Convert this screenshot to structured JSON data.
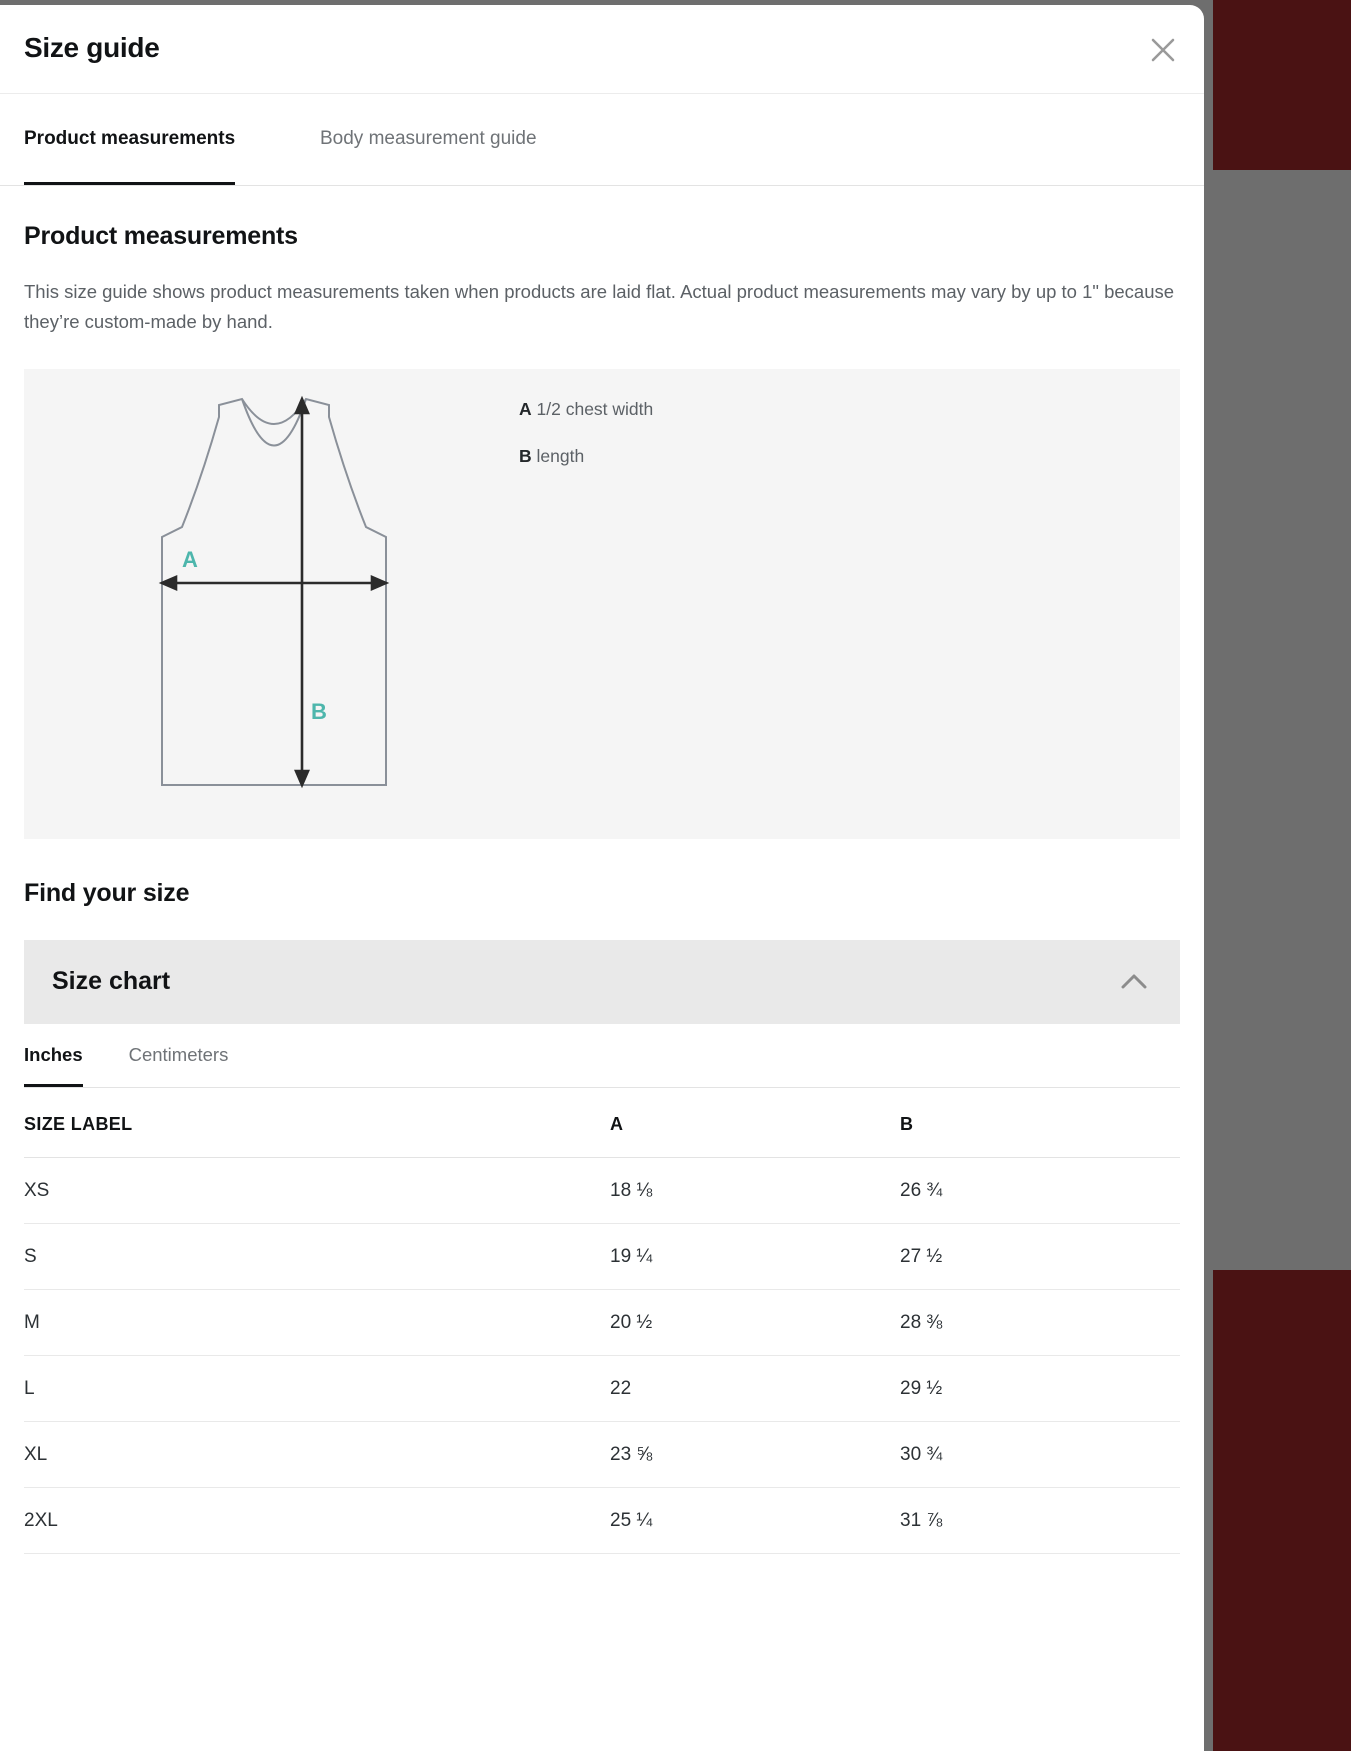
{
  "modal": {
    "title": "Size guide",
    "close_icon": "close-icon"
  },
  "tabs": [
    {
      "label": "Product measurements",
      "active": true
    },
    {
      "label": "Body measurement guide",
      "active": false
    }
  ],
  "sections": {
    "product_measurements": {
      "heading": "Product measurements",
      "description": "This size guide shows product measurements taken when products are laid flat. Actual product measurements may vary by up to 1\" because they’re custom-made by hand."
    },
    "find_your_size": {
      "heading": "Find your size"
    }
  },
  "diagram": {
    "garment": "tank-top-outline",
    "marker_a": "A",
    "marker_b": "B",
    "marker_color": "#4db6ac",
    "outline_color": "#8a9099",
    "arrow_color": "#2b2b2b",
    "panel_color": "#f5f5f5",
    "legend": [
      {
        "key": "A",
        "text": "1/2 chest width"
      },
      {
        "key": "B",
        "text": "length"
      }
    ]
  },
  "accordion": {
    "title": "Size chart",
    "chevron_icon": "chevron-up-icon",
    "expanded": true
  },
  "unit_tabs": [
    {
      "label": "Inches",
      "active": true
    },
    {
      "label": "Centimeters",
      "active": false
    }
  ],
  "chart_data": {
    "type": "table",
    "title": "Size chart",
    "unit": "Inches",
    "columns": [
      "SIZE LABEL",
      "A",
      "B"
    ],
    "column_meanings": {
      "A": "1/2 chest width",
      "B": "length"
    },
    "rows": [
      {
        "size": "XS",
        "a": "18 ⅛",
        "b": "26 ¾"
      },
      {
        "size": "S",
        "a": "19 ¼",
        "b": "27 ½"
      },
      {
        "size": "M",
        "a": "20 ½",
        "b": "28 ⅜"
      },
      {
        "size": "L",
        "a": "22",
        "b": "29 ½"
      },
      {
        "size": "XL",
        "a": "23 ⅝",
        "b": "30 ¾"
      },
      {
        "size": "2XL",
        "a": "25 ¼",
        "b": "31 ⅞"
      }
    ]
  }
}
